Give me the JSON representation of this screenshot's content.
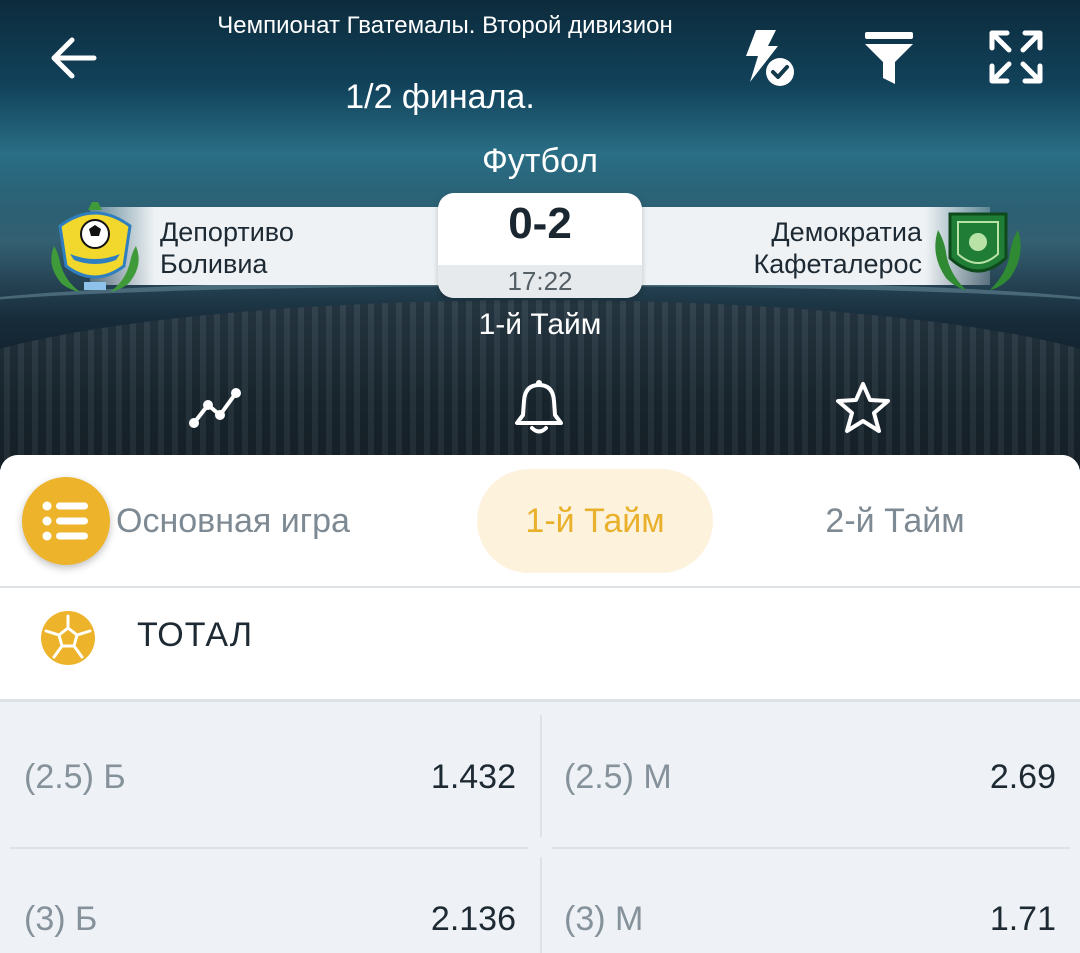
{
  "header": {
    "league": "Чемпионат Гватемалы. Второй дивизион",
    "stage": "1/2 финала.",
    "sport": "Футбол",
    "period": "1-й Тайм"
  },
  "match": {
    "home_team": [
      "Депортиво",
      "Боливиа"
    ],
    "away_team": [
      "Демократиа",
      "Кафеталерос"
    ],
    "score": "0-2",
    "time": "17:22"
  },
  "icons": {
    "back": "arrow-left-icon",
    "quick_bet": "lightning-check-icon",
    "filter": "filter-icon",
    "expand": "expand-icon",
    "stats": "line-chart-icon",
    "notifications": "bell-icon",
    "favorite": "star-icon",
    "menu": "list-icon"
  },
  "tabs": [
    {
      "label": "Основная игра",
      "active": false
    },
    {
      "label": "1-й Тайм",
      "active": true
    },
    {
      "label": "2-й Тайм",
      "active": false
    }
  ],
  "market": {
    "title": "ТОТАЛ",
    "odds": [
      {
        "label": "(2.5) Б",
        "value": "1.432"
      },
      {
        "label": "(2.5) М",
        "value": "2.69"
      },
      {
        "label": "(3) Б",
        "value": "2.136"
      },
      {
        "label": "(3) М",
        "value": "1.71"
      }
    ]
  },
  "colors": {
    "accent": "#edb32a",
    "tab_active_bg": "#fdf2dc",
    "text_dark": "#1e2a33",
    "text_muted": "#86929b"
  }
}
